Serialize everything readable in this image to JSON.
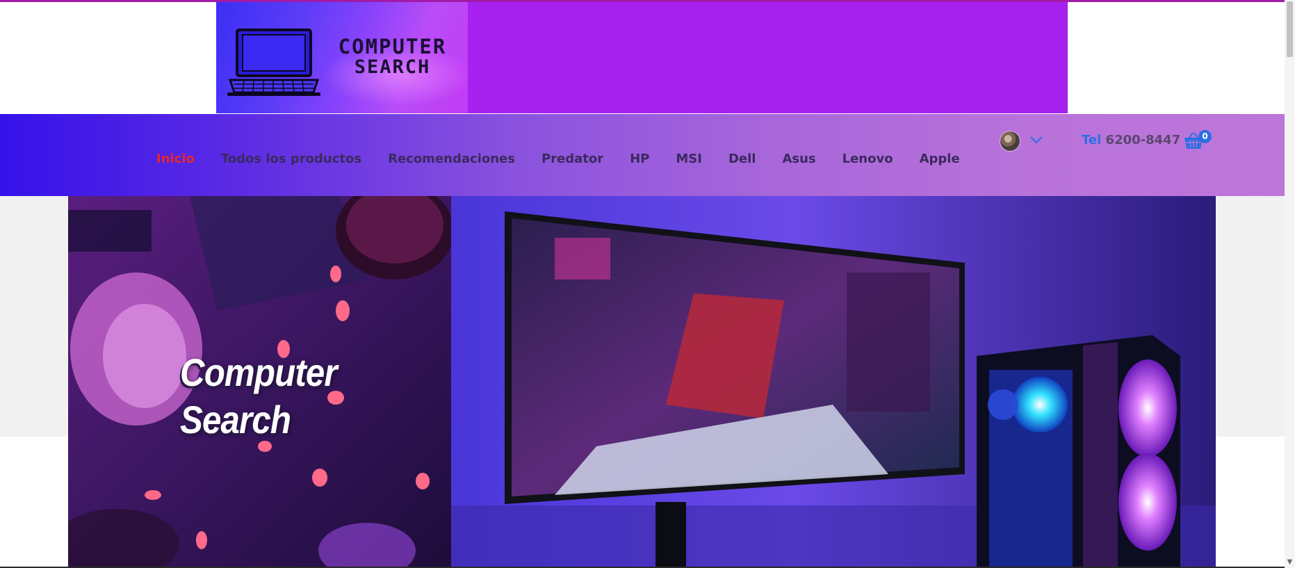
{
  "logo": {
    "line1": "COMPUTER",
    "line2": "SEARCH"
  },
  "nav": {
    "items": [
      {
        "label": "Inicio",
        "active": true
      },
      {
        "label": "Todos los productos",
        "active": false
      },
      {
        "label": "Recomendaciones",
        "active": false
      },
      {
        "label": "Predator",
        "active": false
      },
      {
        "label": "HP",
        "active": false
      },
      {
        "label": "MSI",
        "active": false
      },
      {
        "label": "Dell",
        "active": false
      },
      {
        "label": "Asus",
        "active": false
      },
      {
        "label": "Lenovo",
        "active": false
      },
      {
        "label": "Apple",
        "active": false
      }
    ]
  },
  "account": {
    "avatar_icon": "user-avatar",
    "dropdown_icon": "chevron-down-icon"
  },
  "contact": {
    "phone_label": "Tel",
    "phone_number": "6200-8447"
  },
  "cart": {
    "icon": "shopping-basket-icon",
    "count": "0"
  },
  "hero": {
    "title_line1": "Computer",
    "title_line2": "Search"
  },
  "colors": {
    "banner": "#a722ee",
    "nav_active": "#e5262c",
    "nav_text": "#3a2a5e",
    "accent_blue": "#2b6fe3"
  }
}
